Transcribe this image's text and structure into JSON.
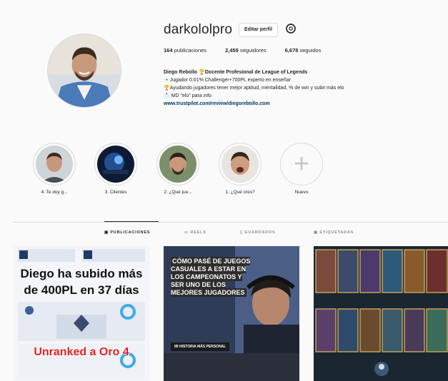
{
  "profile": {
    "username": "darkololpro",
    "edit_label": "Editar perfil",
    "posts_count": "164",
    "posts_label": "publicaciones",
    "followers_count": "2,459",
    "followers_label": "seguidores",
    "following_count": "6,678",
    "following_label": "seguidos"
  },
  "bio": {
    "name": "Diego Rebollo",
    "trophy_emoji": "🏆",
    "title": "Docente Profesional de League of Legends",
    "line1": "🔹Jugador 0.01% Challenger+700PL experto en enseñar",
    "line2": "🏆Ayudando jugadores tener mejor aptitud, mentalidad, % de win y subir más elo",
    "line3": "📩 MD \"elo\" para info",
    "link": "www.trustpilot.com/review/diegorebollo.com"
  },
  "highlights": [
    {
      "label": "4. Te doy g..."
    },
    {
      "label": "3. Clientes"
    },
    {
      "label": "2. ¿Qué jue..."
    },
    {
      "label": "1. ¿Qué cres?"
    },
    {
      "label": "Nuevo"
    }
  ],
  "tabs": [
    {
      "label": "PUBLICACIONES"
    },
    {
      "label": "REELS"
    },
    {
      "label": "GUARDADOS"
    },
    {
      "label": "ETIQUETADAS"
    }
  ],
  "posts": {
    "p1_headline": "Diego ha subido más de 400PL en 37 días",
    "p1_sub": "Unranked a Oro 4",
    "p2_text": "CÓMO PASÉ DE JUEGOS CASUALES A ESTAR EN LOS CAMPEONATOS Y SER UNO DE LOS MEJORES JUGADORES",
    "p2_tag": "MI HISTORIA MÁS PERSONAL"
  },
  "colors": {
    "accent_link": "#00376b",
    "red_text": "#e02020",
    "background": "#fafafa"
  }
}
